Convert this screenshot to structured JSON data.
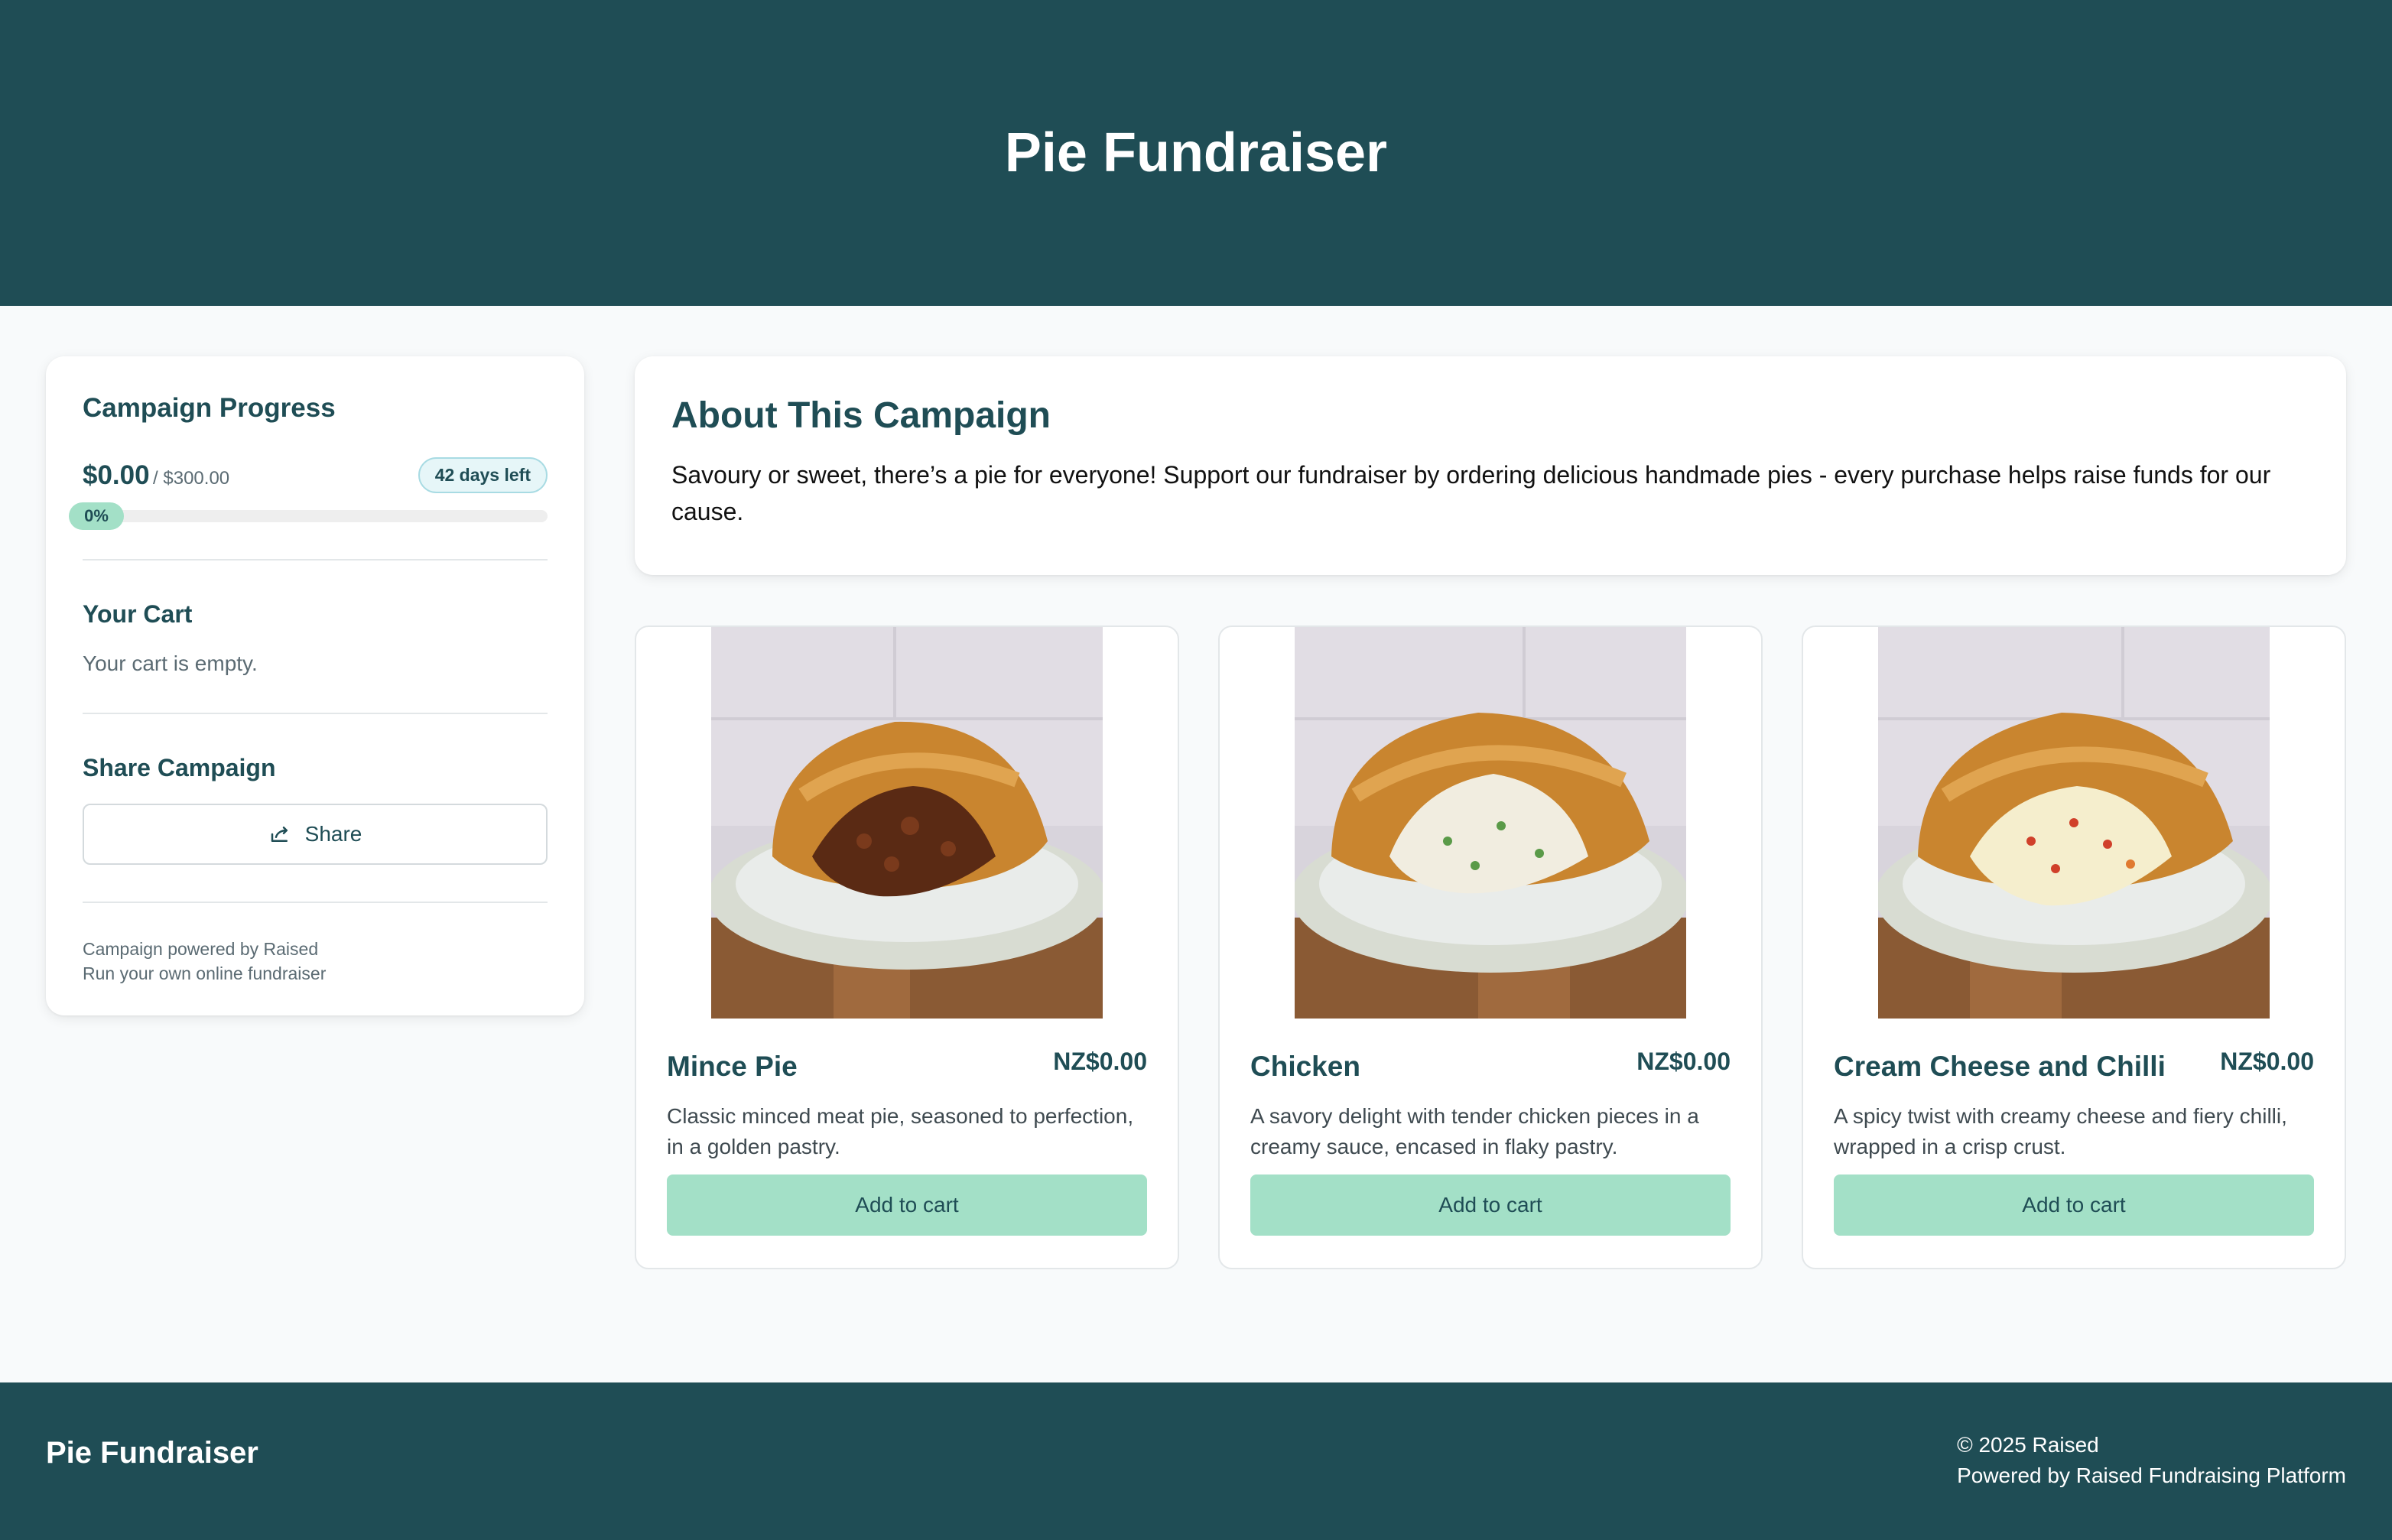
{
  "header": {
    "title": "Pie Fundraiser"
  },
  "progress": {
    "title": "Campaign Progress",
    "raised": "$0.00",
    "goal": "/ $300.00",
    "days_left": "42 days left",
    "percent_label": "0%",
    "percent": 0
  },
  "cart": {
    "title": "Your Cart",
    "empty_text": "Your cart is empty."
  },
  "share": {
    "title": "Share Campaign",
    "button_label": "Share",
    "icon": "share-icon"
  },
  "powered": {
    "line1": "Campaign powered by Raised",
    "line2": "Run your own online fundraiser"
  },
  "about": {
    "title": "About This Campaign",
    "text": "Savoury or sweet, there’s a pie for everyone! Support our fundraiser by ordering delicious handmade pies - every purchase helps raise funds for our cause."
  },
  "products": [
    {
      "name": "Mince Pie",
      "price": "NZ$0.00",
      "description": "Classic minced meat pie, seasoned to perfection, in a golden pastry.",
      "button": "Add to cart",
      "filling": "mince"
    },
    {
      "name": "Chicken",
      "price": "NZ$0.00",
      "description": "A savory delight with tender chicken pieces in a creamy sauce, encased in flaky pastry.",
      "button": "Add to cart",
      "filling": "chicken"
    },
    {
      "name": "Cream Cheese and Chilli",
      "price": "NZ$0.00",
      "description": "A spicy twist with creamy cheese and fiery chilli, wrapped in a crisp crust.",
      "button": "Add to cart",
      "filling": "cheese"
    }
  ],
  "footer": {
    "brand": "Pie Fundraiser",
    "copyright": "© 2025 Raised",
    "powered": "Powered by Raised Fundraising Platform"
  },
  "colors": {
    "primary": "#1f4d55",
    "accent": "#a3e0c7",
    "background": "#f8fafb"
  }
}
